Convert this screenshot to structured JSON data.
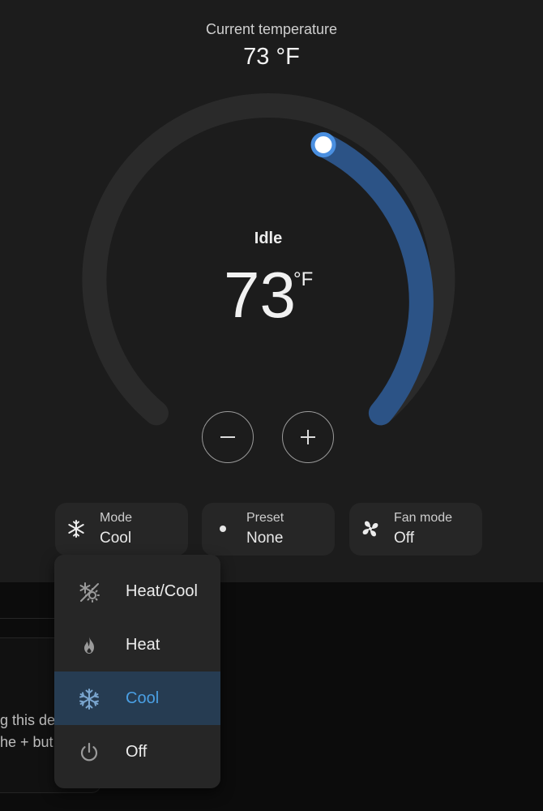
{
  "current": {
    "label": "Current temperature",
    "value": "73 °F"
  },
  "dial": {
    "action": "Idle",
    "target": "73",
    "unit": "°F",
    "track_color": "#2a2a2a",
    "fill_color": "#2c5386",
    "handle_color": "#4a8fe0"
  },
  "chips": {
    "mode": {
      "label": "Mode",
      "value": "Cool",
      "icon": "snowflake-icon"
    },
    "preset": {
      "label": "Preset",
      "value": "None",
      "icon": "dot-icon"
    },
    "fan": {
      "label": "Fan mode",
      "value": "Off",
      "icon": "fan-icon"
    }
  },
  "menu": {
    "items": [
      {
        "label": "Heat/Cool",
        "icon": "sun-snowflake-icon",
        "selected": false
      },
      {
        "label": "Heat",
        "icon": "fire-icon",
        "selected": false
      },
      {
        "label": "Cool",
        "icon": "snowflake-icon",
        "selected": true
      },
      {
        "label": "Off",
        "icon": "power-icon",
        "selected": false
      }
    ],
    "accent": "#4a9fe3",
    "selected_bg": "#263c52"
  },
  "background": {
    "line1": "g this de",
    "line2": "he + but"
  }
}
